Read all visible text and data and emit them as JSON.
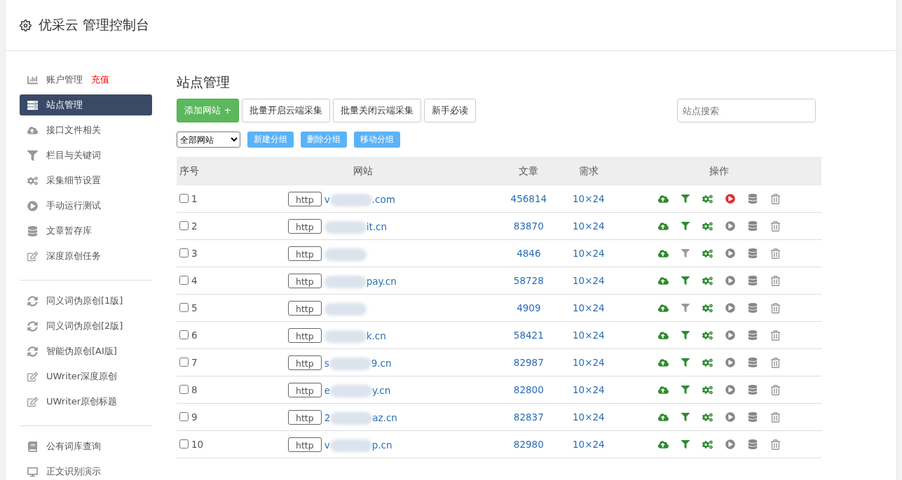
{
  "header": {
    "title": "优采云 管理控制台"
  },
  "sidebar": {
    "groups": [
      {
        "items": [
          {
            "kind": "chart",
            "label": "账户管理",
            "badge": "充值",
            "selected": false
          },
          {
            "kind": "server",
            "label": "站点管理",
            "selected": true
          },
          {
            "kind": "cloud",
            "label": "接口文件相关",
            "selected": false
          },
          {
            "kind": "filter",
            "label": "栏目与关键词",
            "selected": false
          },
          {
            "kind": "gears",
            "label": "采集细节设置",
            "selected": false
          },
          {
            "kind": "play",
            "label": "手动运行测试",
            "selected": false
          },
          {
            "kind": "database",
            "label": "文章暂存库",
            "selected": false
          },
          {
            "kind": "edit",
            "label": "深度原创任务",
            "selected": false
          }
        ]
      },
      {
        "items": [
          {
            "kind": "refresh",
            "label": "同义词伪原创[1版]",
            "selected": false
          },
          {
            "kind": "refresh",
            "label": "同义词伪原创[2版]",
            "selected": false
          },
          {
            "kind": "refresh",
            "label": "智能伪原创[AI版]",
            "selected": false
          },
          {
            "kind": "edit",
            "label": "UWriter深度原创",
            "selected": false
          },
          {
            "kind": "edit",
            "label": "UWriter原创标题",
            "selected": false
          }
        ]
      },
      {
        "items": [
          {
            "kind": "book",
            "label": "公有词库查询",
            "selected": false
          },
          {
            "kind": "monitor",
            "label": "正文识别演示",
            "selected": false
          }
        ]
      }
    ]
  },
  "main": {
    "title": "站点管理",
    "toolbar": [
      {
        "label": "添加网站 +",
        "kind": "primary"
      },
      {
        "label": "批量开启云端采集",
        "kind": "default"
      },
      {
        "label": "批量关闭云端采集",
        "kind": "default"
      },
      {
        "label": "新手必读",
        "kind": "default"
      }
    ],
    "search": {
      "placeholder": "站点搜索"
    },
    "group_select": {
      "value": "全部网站"
    },
    "group_buttons": [
      "新建分组",
      "删除分组",
      "移动分组"
    ],
    "table": {
      "columns": [
        "序号",
        "网站",
        "文章",
        "需求",
        "操作"
      ],
      "rows": [
        {
          "index": "1",
          "checked": false,
          "scheme": "http",
          "site_prefix": "v",
          "site_suffix": ".com",
          "articles": "456814",
          "demand": "10×24",
          "filter_on": true,
          "running": true
        },
        {
          "index": "2",
          "checked": false,
          "scheme": "http",
          "site_suffix": "it.cn",
          "articles": "83870",
          "demand": "10×24",
          "filter_on": true,
          "running": false
        },
        {
          "index": "3",
          "checked": false,
          "scheme": "http",
          "articles": "4846",
          "demand": "10×24",
          "filter_on": false,
          "running": false
        },
        {
          "index": "4",
          "checked": false,
          "scheme": "http",
          "site_suffix": "pay.cn",
          "articles": "58728",
          "demand": "10×24",
          "filter_on": true,
          "running": false
        },
        {
          "index": "5",
          "checked": false,
          "scheme": "http",
          "articles": "4909",
          "demand": "10×24",
          "filter_on": false,
          "running": false
        },
        {
          "index": "6",
          "checked": false,
          "scheme": "http",
          "site_suffix": "k.cn",
          "articles": "58421",
          "demand": "10×24",
          "filter_on": true,
          "running": false
        },
        {
          "index": "7",
          "checked": false,
          "scheme": "http",
          "site_prefix": "s",
          "site_suffix": "9.cn",
          "articles": "82987",
          "demand": "10×24",
          "filter_on": true,
          "running": false
        },
        {
          "index": "8",
          "checked": false,
          "scheme": "http",
          "site_prefix": "e",
          "site_suffix": "y.cn",
          "articles": "82800",
          "demand": "10×24",
          "filter_on": true,
          "running": false
        },
        {
          "index": "9",
          "checked": false,
          "scheme": "http",
          "site_prefix": "2",
          "site_suffix": "az.cn",
          "articles": "82837",
          "demand": "10×24",
          "filter_on": true,
          "running": false
        },
        {
          "index": "10",
          "checked": false,
          "scheme": "http",
          "site_prefix": "v",
          "site_suffix": "p.cn",
          "articles": "82980",
          "demand": "10×24",
          "filter_on": true,
          "running": false
        }
      ]
    }
  }
}
